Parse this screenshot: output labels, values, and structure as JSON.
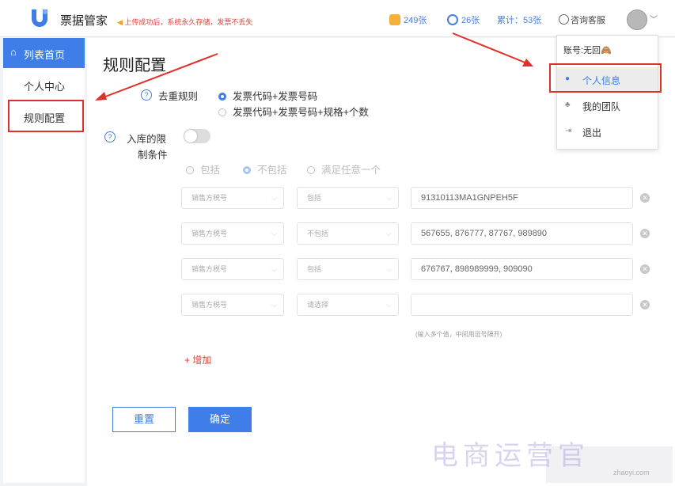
{
  "header": {
    "app_title": "票据管家",
    "notice": "上传成功后，系统永久存储，发票不丢失",
    "stat_1": "249张",
    "stat_2": "26张",
    "stat_total": "累计：53张",
    "consult": "咨询客服",
    "accent_color": "#3f7ee8"
  },
  "sidebar": {
    "items": [
      {
        "label": "列表首页",
        "icon": "home-icon"
      },
      {
        "label": "个人中心"
      },
      {
        "label": "规则配置"
      }
    ]
  },
  "main": {
    "title": "规则配置",
    "dedup_label": "去重规则",
    "dedup_options": [
      "发票代码+发票号码",
      "发票代码+发票号码+规格+个数"
    ],
    "limit_label_1": "入库的限",
    "limit_label_2": "制条件",
    "limit_options": [
      "包括",
      "不包括",
      "满足任意一个"
    ],
    "rows": [
      {
        "field": "销售方税号",
        "op": "包括",
        "value": "91310113MA1GNPEH5F"
      },
      {
        "field": "销售方税号",
        "op": "不包括",
        "value": "567655, 876777, 87767, 989890"
      },
      {
        "field": "销售方税号",
        "op": "包括",
        "value": "676767, 898989999, 909090"
      },
      {
        "field": "销售方税号",
        "op": "请选择",
        "value": ""
      }
    ],
    "hint": "(输入多个值，中间用逗号隔开)",
    "add": "+ 增加",
    "reset": "重置",
    "ok": "确定"
  },
  "dropdown": {
    "account": "账号:无回🙈",
    "items": [
      {
        "label": "个人信息",
        "icon": "user-icon"
      },
      {
        "label": "我的团队",
        "icon": "team-icon"
      },
      {
        "label": "退出",
        "icon": "logout-icon"
      }
    ]
  },
  "watermark": "电商运营官",
  "watermark_small": "zhaoyi.com"
}
